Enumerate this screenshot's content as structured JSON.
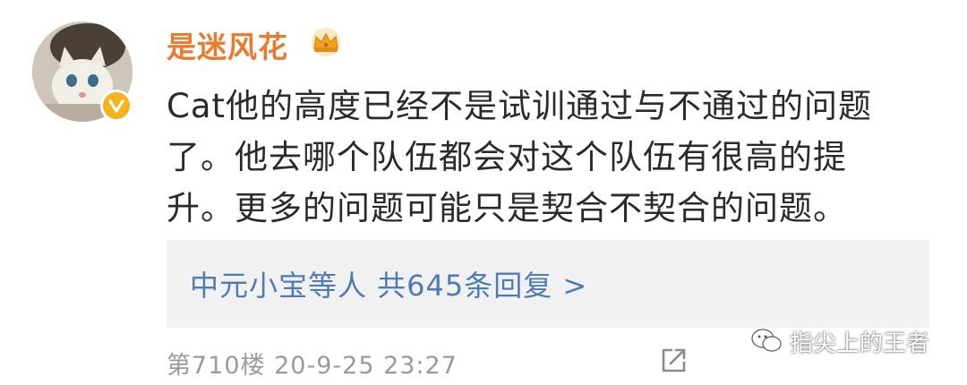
{
  "user": {
    "name": "是迷风花",
    "avatar_icon": "cat-avatar",
    "badge_icon": "verified-v-icon",
    "level_icon": "crown-icon"
  },
  "comment": {
    "lines": [
      "Cat他的高度已经不是试训通过与不通过的问题",
      "了。他去哪个队伍都会对这个队伍有很高的提",
      "升。更多的问题可能只是契合不契合的问题。"
    ]
  },
  "replies": {
    "summary": "中元小宝等人  共645条回复 >"
  },
  "meta": {
    "floor_time": "第710楼  20-9-25 23:27"
  },
  "watermark": {
    "text": "指尖上的王者"
  },
  "colors": {
    "username": "#e97b2c",
    "link": "#4f7bb4",
    "meta": "#9a9a9a",
    "reply_bg": "#f1f1f1"
  }
}
